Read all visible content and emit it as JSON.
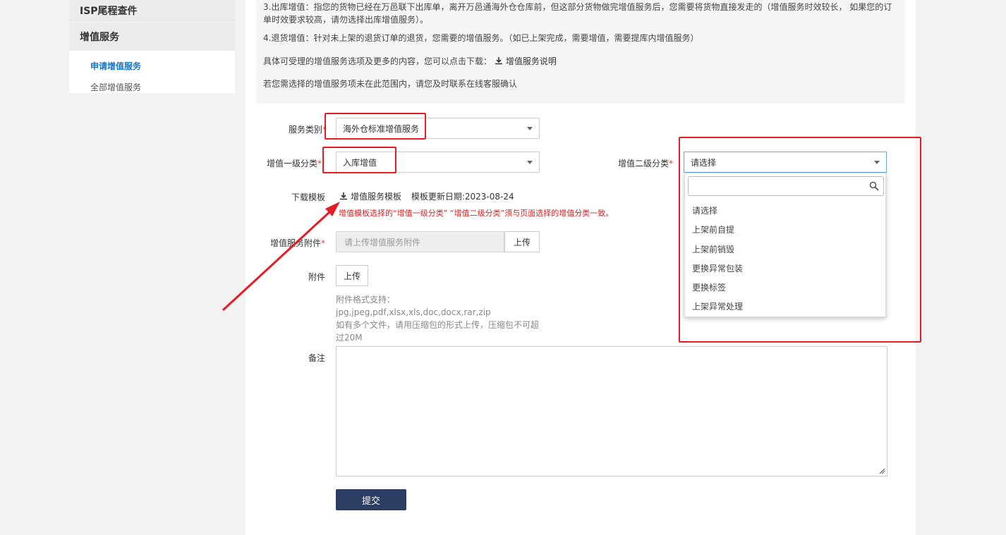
{
  "sidebar": {
    "prev_section": "ISP尾程查件",
    "section_title": "增值服务",
    "items": [
      {
        "label": "申请增值服务",
        "active": true
      },
      {
        "label": "全部增值服务",
        "active": false
      }
    ]
  },
  "notice": {
    "line3a": "3.出库增值：指您的货物已经在万邑联下出库单，离开万邑通海外仓仓库前，但这部分货物做完增值服务后，您需要将货物直接发走的（增值服务时效较长，  如果您的订",
    "line3b": "单时效要求较高，请勿选择出库增值服务）。",
    "line4": "4.退货增值：针对未上架的退货订单的退货，您需要的增值服务。（如已上架完成，需要增值，需要提库内增值服务）",
    "download_prefix": "具体可受理的增值服务选项及更多的内容，您可以点击下载：",
    "download_link": "增值服务说明",
    "contact": "若您需选择的增值服务项未在此范围内，请您及时联系在线客服确认"
  },
  "form": {
    "service_type_label": "服务类别",
    "service_type_value": "海外仓标准增值服务",
    "level1_label": "增值一级分类",
    "level1_value": "入库增值",
    "level2_label": "增值二级分类",
    "level2_value": "请选择",
    "template_label": "下载模板",
    "template_link": "增值服务模板",
    "template_updated": "模板更新日期:2023-08-24",
    "template_warning": "增值模板选择的“增值一级分类” “增值二级分类”须与页面选择的增值分类一致。",
    "attachment_service_label": "增值服务附件",
    "attachment_service_placeholder": "请上传增值服务附件",
    "upload_label": "上传",
    "attachment_label": "附件",
    "hint_line1": "附件格式支持：jpg,jpeg,pdf,xlsx,xls,doc,docx,rar,zip",
    "hint_line2": "如有多个文件，请用压缩包的形式上传，压缩包不可超",
    "hint_line3": "过20M",
    "remark_label": "备注",
    "submit_label": "提交",
    "required_mark": "*"
  },
  "dropdown": {
    "options": [
      "请选择",
      "上架前自提",
      "上架前销毁",
      "更换异常包装",
      "更换标签",
      "上架异常处理"
    ]
  },
  "colors": {
    "accent": "#1a74c7",
    "annotation": "#e51c23",
    "submit_bg": "#2b3d63",
    "warning": "#e02020"
  }
}
